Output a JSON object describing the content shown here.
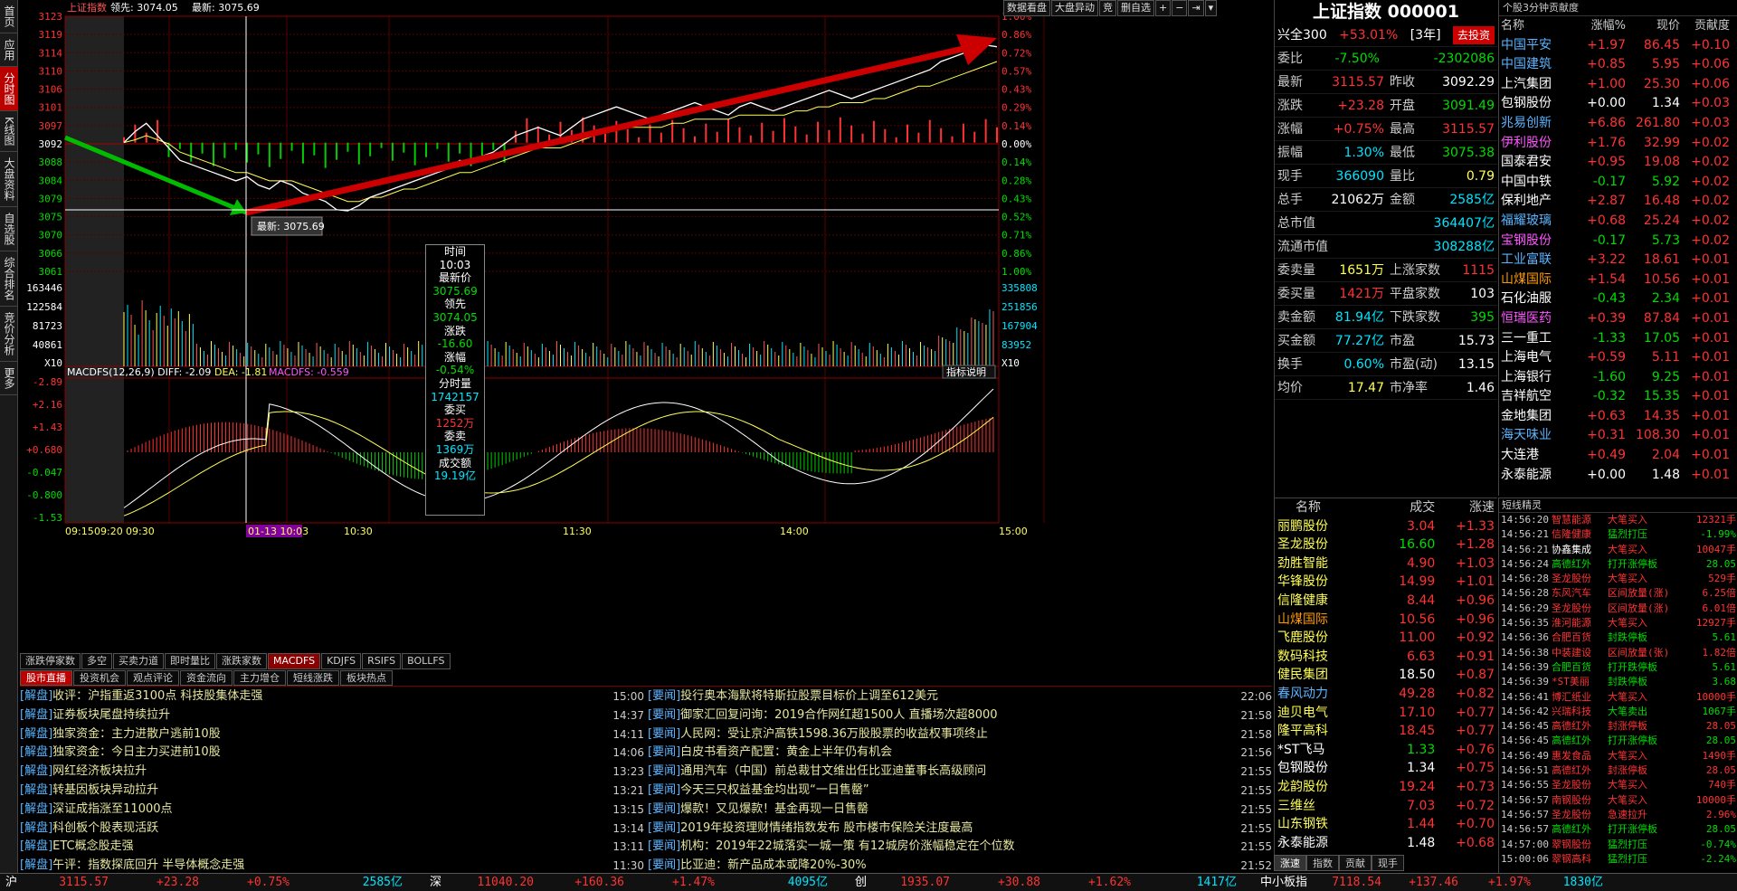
{
  "left_nav": [
    {
      "label": "首页",
      "active": false
    },
    {
      "label": "应用",
      "active": false
    },
    {
      "label": "分时图",
      "active": true
    },
    {
      "label": "K线图",
      "active": false
    },
    {
      "label": "大盘资料",
      "active": false
    },
    {
      "label": "自选股",
      "active": false
    },
    {
      "label": "综合排名",
      "active": false
    },
    {
      "label": "竞价分析",
      "active": false
    },
    {
      "label": "更多",
      "active": false
    }
  ],
  "chart_header": {
    "name": "上证指数",
    "lead_label": "领先: 3074.05",
    "latest_label": "最新: 3075.69"
  },
  "toolbar": {
    "b1": "数据看盘",
    "b2": "大盘异动",
    "b3": "竞",
    "b4": "删自选",
    "b5": "+",
    "b6": "−",
    "b7": "⇥",
    "b8": "▾"
  },
  "chart_data": {
    "type": "line",
    "title": "上证指数 分时",
    "prev_close": 3092.29,
    "price_ticks": [
      3123,
      3119,
      3114,
      3110,
      3106,
      3101,
      3097,
      3092,
      3088,
      3084,
      3079,
      3076,
      3070,
      3066,
      3061
    ],
    "price_ticks_left": [
      3123,
      3119,
      3114,
      3110,
      3106,
      3101,
      3097,
      3092,
      3088,
      3084,
      3079,
      3075,
      3070,
      3066,
      3061
    ],
    "pct_ticks": [
      "1.00%",
      "0.86%",
      "0.72%",
      "0.57%",
      "0.43%",
      "0.29%",
      "0.14%",
      "0.00%",
      "0.14%",
      "0.28%",
      "0.43%",
      "0.52%",
      "0.71%",
      "0.86%",
      "1.00%"
    ],
    "volume_ticks_left": [
      163446,
      122584,
      81723,
      40861
    ],
    "volume_ticks_right": [
      335808,
      251856,
      167904,
      83952
    ],
    "volume_unit": "X10",
    "macd_label": "MACDFS(12,26,9) DIFF: -2.09",
    "macd_dea": "DEA: -1.81",
    "macd_val": "MACDFS: -0.559",
    "macd_ticks": [
      -2.89,
      2.16,
      1.43,
      0.68,
      -0.047,
      -0.8,
      -1.53
    ],
    "macd_ticks_label": [
      "-2.89",
      "+2.16",
      "+1.43",
      "+0.680",
      "-0.047",
      "-0.800",
      "-1.53"
    ],
    "x_labels": [
      "09:15",
      "09:20",
      "09:30",
      "01-13 10:03",
      "10:30",
      "11:30",
      "14:00",
      "15:00"
    ],
    "price_series": [
      3092.3,
      3095,
      3097,
      3094,
      3091,
      3088,
      3087,
      3086,
      3085,
      3084,
      3083,
      3084,
      3082,
      3081,
      3083,
      3082,
      3080,
      3079,
      3078,
      3076,
      3075.7,
      3077,
      3079,
      3080,
      3081,
      3082,
      3083,
      3084,
      3085,
      3086,
      3088,
      3087,
      3089,
      3090,
      3092,
      3094,
      3095,
      3096,
      3095,
      3094,
      3096,
      3098,
      3099,
      3100,
      3101,
      3100,
      3099,
      3098,
      3099,
      3100,
      3101,
      3102,
      3101,
      3100,
      3099,
      3101,
      3102,
      3101,
      3100,
      3101,
      3102,
      3103,
      3104,
      3105,
      3104,
      3103,
      3104,
      3105,
      3106,
      3107,
      3108,
      3109,
      3110,
      3112,
      3113,
      3114,
      3115,
      3116,
      3115.6
    ],
    "avg_series": [
      3092.3,
      3093,
      3094,
      3093,
      3092,
      3090,
      3089,
      3088,
      3087,
      3086,
      3085,
      3085,
      3084,
      3083,
      3083,
      3083,
      3082,
      3081,
      3080,
      3079,
      3078,
      3078,
      3079,
      3079,
      3080,
      3081,
      3081,
      3082,
      3083,
      3084,
      3085,
      3085,
      3086,
      3087,
      3088,
      3089,
      3090,
      3091,
      3091,
      3091,
      3092,
      3093,
      3094,
      3095,
      3096,
      3096,
      3096,
      3096,
      3096,
      3097,
      3097,
      3098,
      3098,
      3098,
      3098,
      3099,
      3099,
      3099,
      3099,
      3099,
      3100,
      3100,
      3101,
      3101,
      3102,
      3102,
      3102,
      3103,
      3103,
      3104,
      3105,
      3106,
      3106,
      3107,
      3108,
      3109,
      3110,
      3111,
      3112
    ],
    "crosshair_label": "最新: 3075.69",
    "indicator_btn": "指标说明"
  },
  "tooltip": {
    "l1": "时间",
    "v1": "10:03",
    "l2": "最新价",
    "v2": "3075.69",
    "l3": "领先",
    "v3": "3074.05",
    "l4": "涨跌",
    "v4": "-16.60",
    "l5": "涨幅",
    "v5": "-0.54%",
    "l6": "分时量",
    "v6": "1742157",
    "l7": "委买",
    "v7": "1252万",
    "l8": "委卖",
    "v8": "1369万",
    "l9": "成交额",
    "v9": "19.19亿"
  },
  "indicator_tabs": [
    "涨跌停家数",
    "多空",
    "买卖力道",
    "即时量比",
    "涨跌家数",
    "MACDFS",
    "KDJFS",
    "RSIFS",
    "BOLLFS"
  ],
  "news_tabs": [
    "股市直播",
    "投资机会",
    "观点评论",
    "资金流向",
    "主力增仓",
    "短线涨跌",
    "板块热点"
  ],
  "news_left": [
    {
      "cat": "[解盘]",
      "title": "收评：沪指重返3100点 科技股集体走强",
      "time": "15:00"
    },
    {
      "cat": "[解盘]",
      "title": "证券板块尾盘持续拉升",
      "time": "14:37"
    },
    {
      "cat": "[解盘]",
      "title": "独家资金：主力进散户逃前10股",
      "time": "14:11"
    },
    {
      "cat": "[解盘]",
      "title": "独家资金：今日主力买进前10股",
      "time": "14:06"
    },
    {
      "cat": "[解盘]",
      "title": "网红经济板块拉升",
      "time": "13:23"
    },
    {
      "cat": "[解盘]",
      "title": "转基因板块异动拉升",
      "time": "13:21"
    },
    {
      "cat": "[解盘]",
      "title": "深证成指涨至11000点",
      "time": "13:15"
    },
    {
      "cat": "[解盘]",
      "title": "科创板个股表现活跃",
      "time": "13:14"
    },
    {
      "cat": "[解盘]",
      "title": "ETC概念股走强",
      "time": "13:11"
    },
    {
      "cat": "[解盘]",
      "title": "午评：指数探底回升 半导体概念走强",
      "time": "11:30"
    }
  ],
  "news_right": [
    {
      "cat": "[要闻]",
      "title": "投行奥本海默将特斯拉股票目标价上调至612美元",
      "time": "22:06"
    },
    {
      "cat": "[要闻]",
      "title": "御家汇回复问询：2019合作网红超1500人 直播场次超8000",
      "time": "21:58"
    },
    {
      "cat": "[要闻]",
      "title": "人民网：受让京沪高铁1598.36万股股票的收益权事项终止",
      "time": "21:58"
    },
    {
      "cat": "[要闻]",
      "title": "白皮书看资产配置：黄金上半年仍有机会",
      "time": "21:56"
    },
    {
      "cat": "[要闻]",
      "title": "通用汽车（中国）前总裁甘文维出任比亚迪董事长高级顾问",
      "time": "21:55"
    },
    {
      "cat": "[要闻]",
      "title": "今天三只权益基金均出现“一日售罄”",
      "time": "21:55"
    },
    {
      "cat": "[要闻]",
      "title": "爆款！又见爆款！基金再现一日售罄",
      "time": "21:55"
    },
    {
      "cat": "[要闻]",
      "title": "2019年投资理财情绪指数发布 股市楼市保险关注度最高",
      "time": "21:55"
    },
    {
      "cat": "[要闻]",
      "title": "机构：2019年22城落实一城一策 有12城房价涨幅稳定在个位数",
      "time": "21:55"
    },
    {
      "cat": "[要闻]",
      "title": "比亚迪：新产品成本或降20%-30%",
      "time": "21:52"
    }
  ],
  "quote": {
    "title": "上证指数 000001",
    "hs300_label": "兴全300",
    "hs300_pct": "+53.01%",
    "hs300_period": "[3年]",
    "hs300_btn": "去投资",
    "rows": [
      {
        "l1": "委比",
        "v1": "-7.50%",
        "c1": "green",
        "l2": "",
        "v2": "-2302086",
        "c2": "green"
      },
      {
        "l1": "最新",
        "v1": "3115.57",
        "c1": "red",
        "l2": "昨收",
        "v2": "3092.29",
        "c2": "white"
      },
      {
        "l1": "涨跌",
        "v1": "+23.28",
        "c1": "red",
        "l2": "开盘",
        "v2": "3091.49",
        "c2": "green"
      },
      {
        "l1": "涨幅",
        "v1": "+0.75%",
        "c1": "red",
        "l2": "最高",
        "v2": "3115.57",
        "c2": "red"
      },
      {
        "l1": "振幅",
        "v1": "1.30%",
        "c1": "cyan",
        "l2": "最低",
        "v2": "3075.38",
        "c2": "green"
      },
      {
        "l1": "现手",
        "v1": "366090",
        "c1": "cyan",
        "l2": "量比",
        "v2": "0.79",
        "c2": "yellow"
      },
      {
        "l1": "总手",
        "v1": "21062万",
        "c1": "white",
        "l2": "金额",
        "v2": "2585亿",
        "c2": "cyan"
      }
    ],
    "mcap_label": "总市值",
    "mcap": "364407亿",
    "float_label": "流通市值",
    "float": "308288亿",
    "rows2": [
      {
        "l1": "委卖量",
        "v1": "1651万",
        "c1": "yellow",
        "l2": "上涨家数",
        "v2": "1115",
        "c2": "red"
      },
      {
        "l1": "委买量",
        "v1": "1421万",
        "c1": "red",
        "l2": "平盘家数",
        "v2": "103",
        "c2": "white"
      },
      {
        "l1": "卖金额",
        "v1": "81.94亿",
        "c1": "cyan",
        "l2": "下跌家数",
        "v2": "395",
        "c2": "green"
      },
      {
        "l1": "买金额",
        "v1": "77.27亿",
        "c1": "cyan",
        "l2": "市盈",
        "v2": "15.73",
        "c2": "white"
      },
      {
        "l1": "换手",
        "v1": "0.60%",
        "c1": "cyan",
        "l2": "市盈(动)",
        "v2": "13.15",
        "c2": "white"
      },
      {
        "l1": "均价",
        "v1": "17.47",
        "c1": "yellow",
        "l2": "市净率",
        "v2": "1.46",
        "c2": "white"
      }
    ]
  },
  "contrib": {
    "header": "个股3分钟贡献度",
    "cols": [
      "名称",
      "涨幅%",
      "现价",
      "贡献度"
    ],
    "rows": [
      {
        "n": "中国平安",
        "nc": "blue",
        "p": "+1.97",
        "pc": "red",
        "x": "86.45",
        "xc": "red",
        "g": "+0.10"
      },
      {
        "n": "中国建筑",
        "nc": "blue",
        "p": "+0.85",
        "pc": "red",
        "x": "5.95",
        "xc": "red",
        "g": "+0.06"
      },
      {
        "n": "上汽集团",
        "nc": "white",
        "p": "+1.00",
        "pc": "red",
        "x": "25.30",
        "xc": "red",
        "g": "+0.06"
      },
      {
        "n": "包钢股份",
        "nc": "white",
        "p": "+0.00",
        "pc": "white",
        "x": "1.34",
        "xc": "white",
        "g": "+0.03"
      },
      {
        "n": "兆易创新",
        "nc": "blue",
        "p": "+6.86",
        "pc": "red",
        "x": "261.80",
        "xc": "red",
        "g": "+0.03"
      },
      {
        "n": "伊利股份",
        "nc": "magenta",
        "p": "+1.76",
        "pc": "red",
        "x": "32.99",
        "xc": "red",
        "g": "+0.02"
      },
      {
        "n": "国泰君安",
        "nc": "white",
        "p": "+0.95",
        "pc": "red",
        "x": "19.08",
        "xc": "red",
        "g": "+0.02"
      },
      {
        "n": "中国中铁",
        "nc": "white",
        "p": "-0.17",
        "pc": "green",
        "x": "5.92",
        "xc": "green",
        "g": "+0.02"
      },
      {
        "n": "保利地产",
        "nc": "white",
        "p": "+2.87",
        "pc": "red",
        "x": "16.48",
        "xc": "red",
        "g": "+0.02"
      },
      {
        "n": "福耀玻璃",
        "nc": "blue",
        "p": "+0.68",
        "pc": "red",
        "x": "25.24",
        "xc": "red",
        "g": "+0.02"
      },
      {
        "n": "宝钢股份",
        "nc": "magenta",
        "p": "-0.17",
        "pc": "green",
        "x": "5.73",
        "xc": "green",
        "g": "+0.02"
      },
      {
        "n": "工业富联",
        "nc": "blue",
        "p": "+3.22",
        "pc": "red",
        "x": "18.61",
        "xc": "red",
        "g": "+0.01"
      },
      {
        "n": "山煤国际",
        "nc": "orange",
        "p": "+1.54",
        "pc": "red",
        "x": "10.56",
        "xc": "red",
        "g": "+0.01"
      },
      {
        "n": "石化油服",
        "nc": "white",
        "p": "-0.43",
        "pc": "green",
        "x": "2.34",
        "xc": "green",
        "g": "+0.01"
      },
      {
        "n": "恒瑞医药",
        "nc": "magenta",
        "p": "+0.39",
        "pc": "red",
        "x": "87.84",
        "xc": "red",
        "g": "+0.01"
      },
      {
        "n": "三一重工",
        "nc": "white",
        "p": "-1.33",
        "pc": "green",
        "x": "17.05",
        "xc": "green",
        "g": "+0.01"
      },
      {
        "n": "上海电气",
        "nc": "white",
        "p": "+0.59",
        "pc": "red",
        "x": "5.11",
        "xc": "red",
        "g": "+0.01"
      },
      {
        "n": "上海银行",
        "nc": "white",
        "p": "-1.60",
        "pc": "green",
        "x": "9.25",
        "xc": "green",
        "g": "+0.01"
      },
      {
        "n": "吉祥航空",
        "nc": "white",
        "p": "-0.32",
        "pc": "green",
        "x": "15.35",
        "xc": "green",
        "g": "+0.01"
      },
      {
        "n": "金地集团",
        "nc": "white",
        "p": "+0.63",
        "pc": "red",
        "x": "14.35",
        "xc": "red",
        "g": "+0.01"
      },
      {
        "n": "海天味业",
        "nc": "blue",
        "p": "+0.31",
        "pc": "red",
        "x": "108.30",
        "xc": "red",
        "g": "+0.01"
      },
      {
        "n": "大连港",
        "nc": "white",
        "p": "+0.49",
        "pc": "red",
        "x": "2.04",
        "xc": "red",
        "g": "+0.01"
      },
      {
        "n": "永泰能源",
        "nc": "white",
        "p": "+0.00",
        "pc": "white",
        "x": "1.48",
        "xc": "white",
        "g": "+0.01"
      }
    ]
  },
  "speed": {
    "cols": [
      "名称",
      "成交",
      "涨速"
    ],
    "rows": [
      {
        "n": "丽鹏股份",
        "nc": "yellow",
        "v": "3.04",
        "vc": "red",
        "s": "+1.33"
      },
      {
        "n": "圣龙股份",
        "nc": "yellow",
        "v": "16.60",
        "vc": "green",
        "s": "+1.28"
      },
      {
        "n": "劲胜智能",
        "nc": "yellow",
        "v": "4.90",
        "vc": "red",
        "s": "+1.03"
      },
      {
        "n": "华锋股份",
        "nc": "yellow",
        "v": "14.99",
        "vc": "red",
        "s": "+1.01"
      },
      {
        "n": "信隆健康",
        "nc": "yellow",
        "v": "8.44",
        "vc": "red",
        "s": "+0.96"
      },
      {
        "n": "山煤国际",
        "nc": "orange",
        "v": "10.56",
        "vc": "red",
        "s": "+0.96"
      },
      {
        "n": "飞鹿股份",
        "nc": "yellow",
        "v": "11.00",
        "vc": "red",
        "s": "+0.92"
      },
      {
        "n": "数码科技",
        "nc": "yellow",
        "v": "6.63",
        "vc": "red",
        "s": "+0.91"
      },
      {
        "n": "健民集团",
        "nc": "yellow",
        "v": "18.50",
        "vc": "white",
        "s": "+0.87"
      },
      {
        "n": "春风动力",
        "nc": "blue",
        "v": "49.28",
        "vc": "red",
        "s": "+0.82"
      },
      {
        "n": "迪贝电气",
        "nc": "yellow",
        "v": "17.10",
        "vc": "red",
        "s": "+0.77"
      },
      {
        "n": "隆平高科",
        "nc": "yellow",
        "v": "18.45",
        "vc": "red",
        "s": "+0.77"
      },
      {
        "n": "*ST飞马",
        "nc": "white",
        "v": "1.33",
        "vc": "green",
        "s": "+0.76"
      },
      {
        "n": "包钢股份",
        "nc": "white",
        "v": "1.34",
        "vc": "white",
        "s": "+0.75"
      },
      {
        "n": "龙韵股份",
        "nc": "yellow",
        "v": "19.24",
        "vc": "red",
        "s": "+0.73"
      },
      {
        "n": "三维丝",
        "nc": "yellow",
        "v": "7.03",
        "vc": "red",
        "s": "+0.72"
      },
      {
        "n": "山东钢铁",
        "nc": "yellow",
        "v": "1.44",
        "vc": "red",
        "s": "+0.70"
      },
      {
        "n": "永泰能源",
        "nc": "white",
        "v": "1.48",
        "vc": "white",
        "s": "+0.68"
      }
    ]
  },
  "speed_tabs": [
    "涨速",
    "指数",
    "贡献",
    "现手"
  ],
  "sprite": {
    "header": "短线精灵",
    "rows": [
      {
        "t": "14:56:20",
        "n": "智慧能源",
        "nc": "red",
        "e": "大笔买入",
        "ec": "red",
        "v": "12321手"
      },
      {
        "t": "14:56:21",
        "n": "信隆健康",
        "nc": "red",
        "e": "猛烈打压",
        "ec": "green",
        "v": "-1.99%"
      },
      {
        "t": "14:56:21",
        "n": "协鑫集成",
        "nc": "white",
        "e": "大笔买入",
        "ec": "red",
        "v": "10047手"
      },
      {
        "t": "14:56:24",
        "n": "高德红外",
        "nc": "green",
        "e": "打开涨停板",
        "ec": "green",
        "v": "28.05"
      },
      {
        "t": "14:56:28",
        "n": "圣龙股份",
        "nc": "red",
        "e": "大笔买入",
        "ec": "red",
        "v": "529手"
      },
      {
        "t": "14:56:28",
        "n": "东风汽车",
        "nc": "red",
        "e": "区间放量(涨)",
        "ec": "red",
        "v": "6.25倍"
      },
      {
        "t": "14:56:29",
        "n": "圣龙股份",
        "nc": "red",
        "e": "区间放量(涨)",
        "ec": "red",
        "v": "6.01倍"
      },
      {
        "t": "14:56:35",
        "n": "淮河能源",
        "nc": "red",
        "e": "大笔买入",
        "ec": "red",
        "v": "12927手"
      },
      {
        "t": "14:56:36",
        "n": "合肥百货",
        "nc": "red",
        "e": "封跌停板",
        "ec": "green",
        "v": "5.61"
      },
      {
        "t": "14:56:38",
        "n": "中装建设",
        "nc": "red",
        "e": "区间放量(张)",
        "ec": "red",
        "v": "1.82倍"
      },
      {
        "t": "14:56:39",
        "n": "合肥百货",
        "nc": "green",
        "e": "打开跌停板",
        "ec": "green",
        "v": "5.61"
      },
      {
        "t": "14:56:39",
        "n": "*ST美丽",
        "nc": "red",
        "e": "封跌停板",
        "ec": "green",
        "v": "3.68"
      },
      {
        "t": "14:56:41",
        "n": "博汇纸业",
        "nc": "red",
        "e": "大笔买入",
        "ec": "red",
        "v": "10000手"
      },
      {
        "t": "14:56:42",
        "n": "兴瑞科技",
        "nc": "red",
        "e": "大笔卖出",
        "ec": "green",
        "v": "1067手"
      },
      {
        "t": "14:56:45",
        "n": "高德红外",
        "nc": "red",
        "e": "封涨停板",
        "ec": "red",
        "v": "28.05"
      },
      {
        "t": "14:56:45",
        "n": "高德红外",
        "nc": "green",
        "e": "打开涨停板",
        "ec": "green",
        "v": "28.05"
      },
      {
        "t": "14:56:49",
        "n": "惠发食品",
        "nc": "red",
        "e": "大笔买入",
        "ec": "red",
        "v": "1490手"
      },
      {
        "t": "14:56:51",
        "n": "高德红外",
        "nc": "red",
        "e": "封涨停板",
        "ec": "red",
        "v": "28.05"
      },
      {
        "t": "14:56:55",
        "n": "圣龙股份",
        "nc": "red",
        "e": "大笔买入",
        "ec": "red",
        "v": "740手"
      },
      {
        "t": "14:56:57",
        "n": "南钢股份",
        "nc": "red",
        "e": "大笔买入",
        "ec": "red",
        "v": "10000手"
      },
      {
        "t": "14:56:57",
        "n": "圣龙股份",
        "nc": "red",
        "e": "急速拉升",
        "ec": "red",
        "v": "2.96%"
      },
      {
        "t": "14:56:57",
        "n": "高德红外",
        "nc": "green",
        "e": "打开涨停板",
        "ec": "green",
        "v": "28.05"
      },
      {
        "t": "14:57:00",
        "n": "翠钢股份",
        "nc": "red",
        "e": "猛烈打压",
        "ec": "green",
        "v": "-0.74%"
      },
      {
        "t": "15:00:06",
        "n": "翠钢高科",
        "nc": "red",
        "e": "猛烈打压",
        "ec": "green",
        "v": "-2.24%"
      }
    ]
  },
  "status": {
    "sh_label": "沪",
    "sh_price": "3115.57",
    "sh_chg": "+23.28",
    "sh_pct": "+0.75%",
    "sh_amt": "2585亿",
    "sz_label": "深",
    "sz_price": "11040.20",
    "sz_chg": "+160.36",
    "sz_pct": "+1.47%",
    "sz_amt": "4095亿",
    "cy_label": "创",
    "cy_price": "1935.07",
    "cy_chg": "+30.88",
    "cy_pct": "+1.62%",
    "cy_amt": "1417亿",
    "zx_label": "中小板指",
    "zx_price": "7118.54",
    "zx_chg": "+137.46",
    "zx_pct": "+1.97%",
    "zx_amt": "1830亿"
  }
}
